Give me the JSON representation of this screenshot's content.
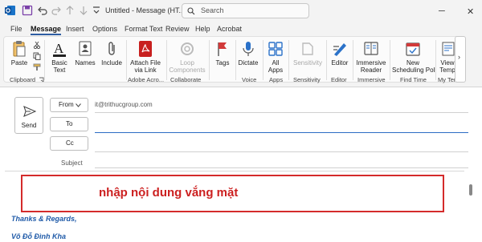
{
  "titlebar": {
    "title": "Untitled - Message (HT...",
    "search_label": "Search",
    "minimize": "─",
    "close": "✕"
  },
  "menu": {
    "items": [
      "File",
      "Message",
      "Insert",
      "Options",
      "Format Text",
      "Review",
      "Help",
      "Acrobat"
    ],
    "active": "Message"
  },
  "ribbon": {
    "paste": "Paste",
    "basic_text": [
      "Basic",
      "Text"
    ],
    "names": "Names",
    "include": "Include",
    "attach_link": [
      "Attach File",
      "via Link"
    ],
    "loop": [
      "Loop",
      "Components"
    ],
    "tags": "Tags",
    "dictate": "Dictate",
    "apps": [
      "All",
      "Apps"
    ],
    "sensitivity": "Sensitivity",
    "editor": "Editor",
    "immersive": [
      "Immersive",
      "Reader"
    ],
    "scheduling": [
      "New",
      "Scheduling Poll"
    ],
    "view": [
      "View",
      "Temp"
    ],
    "groups": [
      "Clipboard",
      "Adobe Acro...",
      "Collaborate",
      "Voice",
      "Apps",
      "Sensitivity",
      "Editor",
      "Immersive",
      "Find Time",
      "My Tem"
    ]
  },
  "compose": {
    "send_label": "Send",
    "from_label": "From",
    "from_value": "it@trithucgroup.com",
    "to_label": "To",
    "cc_label": "Cc",
    "subject_label": "Subject"
  },
  "body": {
    "annotation": "nhập nội dung vắng mặt",
    "signature_1": "Thanks & Regards,",
    "signature_2": "Võ Đỗ Đình Kha"
  },
  "colors": {
    "accent": "#2f5ea3",
    "annotation_border": "#d42b2b",
    "signature": "#1f5aa8"
  }
}
